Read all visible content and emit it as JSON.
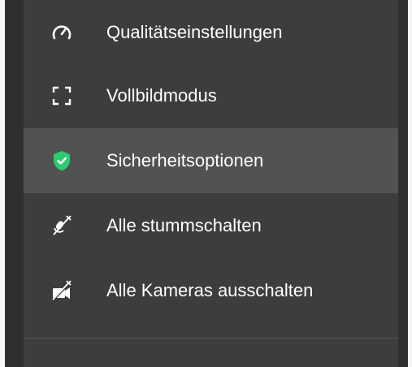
{
  "menu": {
    "items": [
      {
        "label": "Qualitätseinstellungen",
        "icon": "gauge-icon"
      },
      {
        "label": "Vollbildmodus",
        "icon": "fullscreen-icon"
      },
      {
        "label": "Sicherheitsoptionen",
        "icon": "shield-check-icon",
        "selected": true
      },
      {
        "label": "Alle stummschalten",
        "icon": "microphone-muted-icon"
      },
      {
        "label": "Alle Kameras ausschalten",
        "icon": "camera-off-icon"
      }
    ]
  },
  "colors": {
    "panel_background": "#3d3d3d",
    "selected_background": "#525252",
    "text": "#ffffff",
    "shield_green": "#2ecc71"
  }
}
